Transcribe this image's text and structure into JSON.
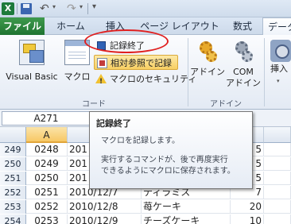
{
  "qat": {
    "app_icon_letter": "X",
    "undo_glyph": "↶",
    "redo_glyph": "↷",
    "dropdown_glyph": "▾",
    "customize_glyph": "▾"
  },
  "tabs": [
    "ファイル",
    "ホーム",
    "挿入",
    "ページ レイアウト",
    "数式",
    "データ"
  ],
  "ribbon": {
    "code_group": {
      "visual_basic": "Visual Basic",
      "macro": "マクロ",
      "stop_recording": "記録終了",
      "relative_ref": "相対参照で記録",
      "macro_security": "マクロのセキュリティ",
      "label": "コード"
    },
    "addin_group": {
      "addins": "アドイン",
      "com_line1": "COM",
      "com_line2": "アドイン",
      "label": "アドイン"
    },
    "insert_label": "挿入"
  },
  "formula_bar": {
    "name_box": "A271"
  },
  "columns": [
    "A"
  ],
  "rows": [
    {
      "num": "249",
      "a": "0248",
      "b": "201",
      "c": "",
      "d": "5"
    },
    {
      "num": "250",
      "a": "0249",
      "b": "201",
      "c": "",
      "d": "5"
    },
    {
      "num": "251",
      "a": "0250",
      "b": "201",
      "c": "",
      "d": "5"
    },
    {
      "num": "252",
      "a": "0251",
      "b": "2010/12/7",
      "c": "ティラミス",
      "d": "7"
    },
    {
      "num": "253",
      "a": "0252",
      "b": "2010/12/8",
      "c": "苺ケーキ",
      "d": "20"
    },
    {
      "num": "254",
      "a": "0253",
      "b": "2010/12/9",
      "c": "チーズケーキ",
      "d": "10"
    }
  ],
  "tooltip": {
    "title": "記録終了",
    "line1": "マクロを記録します。",
    "line2": "実行するコマンドが、後で再度実行",
    "line3": "できるようにマクロに保存されます。"
  },
  "colors": {
    "file_tab": "#1f7431",
    "highlight": "#e02020",
    "active_button": "#f8cf62"
  }
}
